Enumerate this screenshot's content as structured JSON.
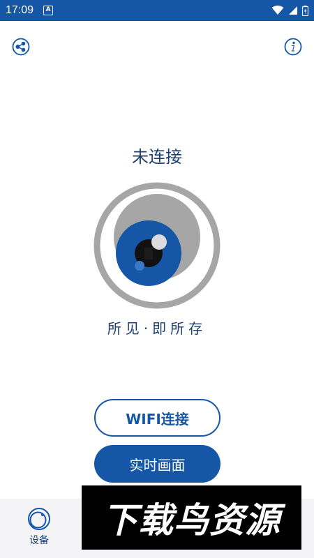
{
  "status_bar": {
    "time": "17:09",
    "notification_icon_letter": "A",
    "icons": [
      "wifi-icon",
      "signal-icon",
      "battery-icon"
    ],
    "background_color": "#1557a6"
  },
  "header": {
    "left_icon": "share-icon",
    "right_icon": "info-icon"
  },
  "main": {
    "connection_status": "未连接",
    "slogan": "所见·即所存",
    "logo_icon": "eye-camera-icon"
  },
  "buttons": {
    "wifi_connect": "WIFI连接",
    "live_view": "实时画面"
  },
  "bottom_nav": {
    "items": [
      {
        "label": "设备",
        "icon": "device-ring-icon"
      }
    ]
  },
  "watermark": {
    "text": "下载鸟资源"
  },
  "colors": {
    "brand_blue": "#1557a6",
    "text_navy": "#1c3f73",
    "logo_gray": "#a6a6a6"
  }
}
